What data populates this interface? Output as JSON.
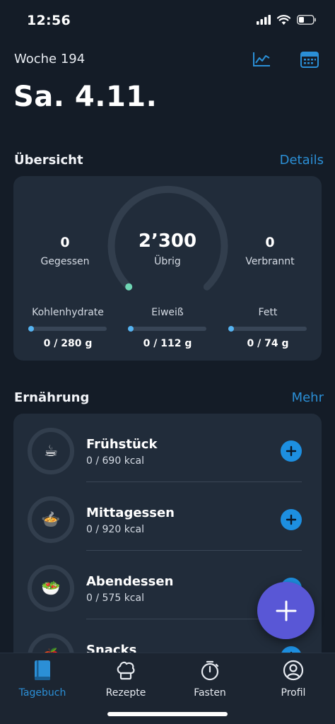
{
  "status_bar": {
    "time": "12:56",
    "icons": [
      "signal-icon",
      "wifi-icon",
      "battery-icon"
    ]
  },
  "header": {
    "week": "Woche 194",
    "date": "Sa. 4.11.",
    "icons": [
      "chart-icon",
      "calendar-icon"
    ]
  },
  "overview": {
    "title": "Übersicht",
    "link": "Details",
    "eaten": {
      "value": "0",
      "label": "Gegessen"
    },
    "remaining": {
      "value": "2’300",
      "label": "Übrig"
    },
    "burned": {
      "value": "0",
      "label": "Verbrannt"
    },
    "macros": [
      {
        "label": "Kohlenhydrate",
        "value": "0 / 280 g",
        "progress": 0
      },
      {
        "label": "Eiweiß",
        "value": "0 / 112 g",
        "progress": 0
      },
      {
        "label": "Fett",
        "value": "0 / 74 g",
        "progress": 0
      }
    ]
  },
  "nutrition": {
    "title": "Ernährung",
    "link": "Mehr",
    "meals": [
      {
        "name": "Frühstück",
        "kcal": "0 / 690 kcal",
        "icon": "coffee-cup-icon",
        "emoji": "☕"
      },
      {
        "name": "Mittagessen",
        "kcal": "0 / 920 kcal",
        "icon": "soup-bowl-icon",
        "emoji": "🍲"
      },
      {
        "name": "Abendessen",
        "kcal": "0 / 575 kcal",
        "icon": "salad-icon",
        "emoji": "🥗"
      },
      {
        "name": "Snacks",
        "kcal": "",
        "icon": "apple-icon",
        "emoji": "🍎"
      }
    ]
  },
  "tabs": [
    {
      "label": "Tagebuch",
      "icon": "book-icon",
      "active": true
    },
    {
      "label": "Rezepte",
      "icon": "chef-hat-icon",
      "active": false
    },
    {
      "label": "Fasten",
      "icon": "stopwatch-icon",
      "active": false
    },
    {
      "label": "Profil",
      "icon": "profile-icon",
      "active": false
    }
  ],
  "colors": {
    "accent": "#2b8fd6",
    "fab": "#5957d6",
    "background": "#141c27",
    "card": "#212c3a",
    "ring_dot": "#6fd6b4"
  }
}
